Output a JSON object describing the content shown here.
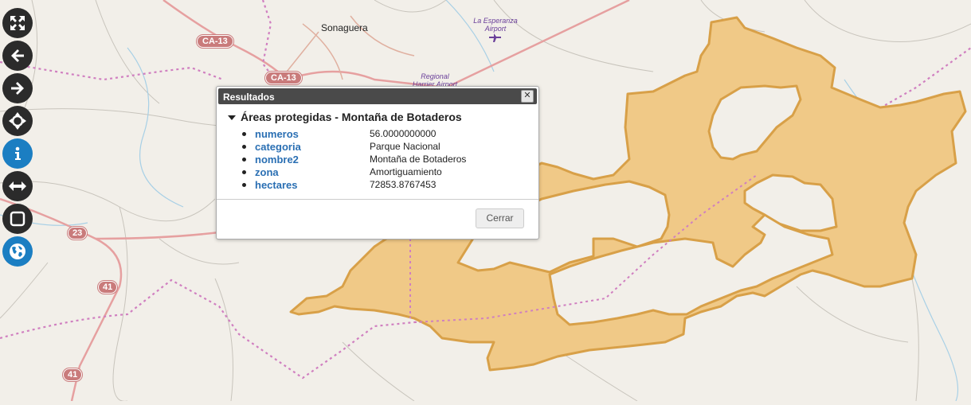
{
  "map": {
    "towns": [
      {
        "id": "sonaguera",
        "name": "Sonaguera"
      }
    ],
    "airports": [
      {
        "id": "la-esperanza",
        "name": "La Esperanza Airport"
      },
      {
        "id": "regional-harrier",
        "name": "Regional Harrier Airport"
      }
    ],
    "road_shields": [
      "CA-13",
      "CA-13",
      "23",
      "41",
      "41"
    ],
    "colors": {
      "background": "#f2efe9",
      "protected_area_fill": "#f0c987",
      "protected_area_stroke": "#d8a048",
      "boundary_dotted": "#d07fc0",
      "road_major": "#e6a0a0",
      "river": "#a8d0e6"
    }
  },
  "toolbar": [
    {
      "name": "fullscreen-button",
      "icon": "expand-arrows-icon"
    },
    {
      "name": "back-button",
      "icon": "arrow-left-icon"
    },
    {
      "name": "forward-button",
      "icon": "arrow-right-icon"
    },
    {
      "name": "locate-button",
      "icon": "crosshair-icon"
    },
    {
      "name": "info-button",
      "icon": "info-icon"
    },
    {
      "name": "measure-line-button",
      "icon": "horizontal-arrows-icon"
    },
    {
      "name": "measure-area-button",
      "icon": "square-icon"
    },
    {
      "name": "layers-button",
      "icon": "globe-icon"
    }
  ],
  "popup": {
    "title": "Resultados",
    "close_glyph": "✕",
    "heading": "Áreas protegidas - Montaña de Botaderos",
    "attributes": [
      {
        "key": "numeros",
        "value": "56.0000000000"
      },
      {
        "key": "categoria",
        "value": "Parque Nacional"
      },
      {
        "key": "nombre2",
        "value": "Montaña de Botaderos"
      },
      {
        "key": "zona",
        "value": "Amortiguamiento"
      },
      {
        "key": "hectares",
        "value": "72853.8767453"
      }
    ],
    "close_button_label": "Cerrar"
  }
}
